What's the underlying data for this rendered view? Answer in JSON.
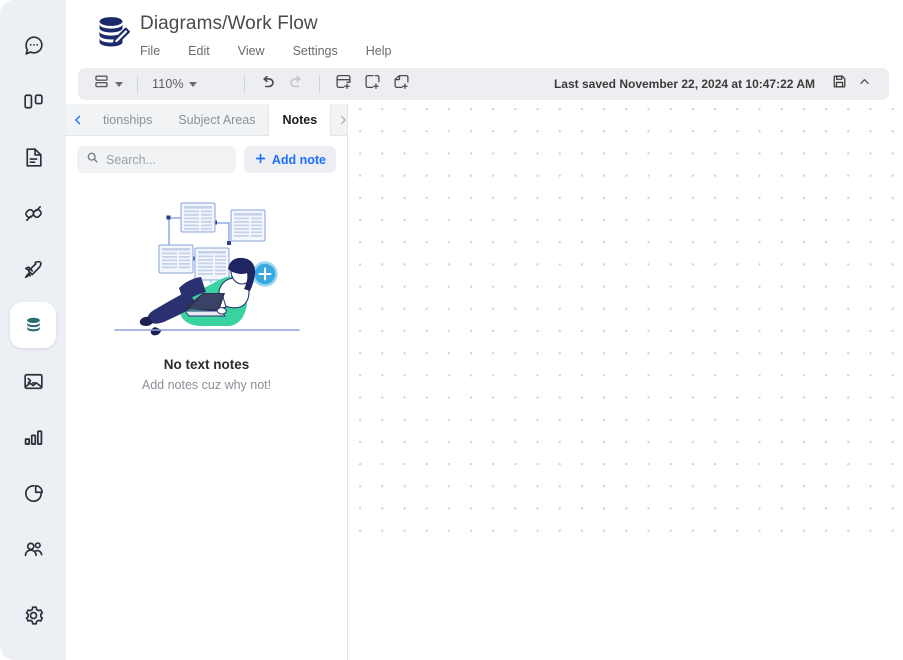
{
  "rail": {
    "items": [
      {
        "name": "chat-icon",
        "label": "Chat",
        "active": false
      },
      {
        "name": "board-icon",
        "label": "Board",
        "active": false
      },
      {
        "name": "document-icon",
        "label": "Documents",
        "active": false
      },
      {
        "name": "plug-icon",
        "label": "Connections",
        "active": false
      },
      {
        "name": "rocket-icon",
        "label": "Launch",
        "active": false
      },
      {
        "name": "database-icon",
        "label": "Diagrams",
        "active": true
      },
      {
        "name": "image-icon",
        "label": "Media",
        "active": false
      },
      {
        "name": "bar-chart-icon",
        "label": "Analytics",
        "active": false
      },
      {
        "name": "pie-chart-icon",
        "label": "Reports",
        "active": false
      },
      {
        "name": "users-icon",
        "label": "Team",
        "active": false
      },
      {
        "name": "gear-icon",
        "label": "Settings",
        "active": false
      }
    ]
  },
  "header": {
    "title": "Diagrams/Work Flow",
    "logo_icon": "database-pencil-logo",
    "menu": [
      {
        "label": "File"
      },
      {
        "label": "Edit"
      },
      {
        "label": "View"
      },
      {
        "label": "Settings"
      },
      {
        "label": "Help"
      }
    ]
  },
  "toolbar": {
    "layout_icon": "layout-rows-icon",
    "zoom_level": "110%",
    "undo_icon": "undo-arrow-icon",
    "redo_icon": "redo-arrow-icon",
    "add_table_icon": "add-table-icon",
    "add_area_icon": "add-subject-area-icon",
    "add_note_icon": "add-note-shape-icon",
    "saved_text": "Last saved November 22, 2024 at 10:47:22 AM",
    "save_icon": "floppy-disk-save-icon",
    "collapse_icon": "chevron-up-icon"
  },
  "panel": {
    "tabs": [
      {
        "label": "tionships",
        "active": false
      },
      {
        "label": "Subject Areas",
        "active": false
      },
      {
        "label": "Notes",
        "active": true
      }
    ],
    "prev_tab_icon": "chevron-left-icon",
    "next_tab_icon": "chevron-right-icon",
    "search": {
      "icon": "search-icon",
      "placeholder": "Search...",
      "value": ""
    },
    "add_note_button": {
      "icon": "plus-icon",
      "label": "Add note"
    },
    "empty_state": {
      "illustration": "person-on-beanbag-with-diagram-illustration",
      "title": "No text notes",
      "subtitle": "Add notes cuz why not!"
    }
  },
  "canvas": {
    "grid": "dot-grid"
  },
  "colors": {
    "rail_bg": "#eceff4",
    "accent_blue": "#1e6fff",
    "logo_navy": "#1b2a6b",
    "active_teal": "#2d6e72",
    "grid_dot": "#6f8fd8",
    "toolbar_bg": "#eceef1",
    "beanbag_green": "#3ad29f"
  }
}
